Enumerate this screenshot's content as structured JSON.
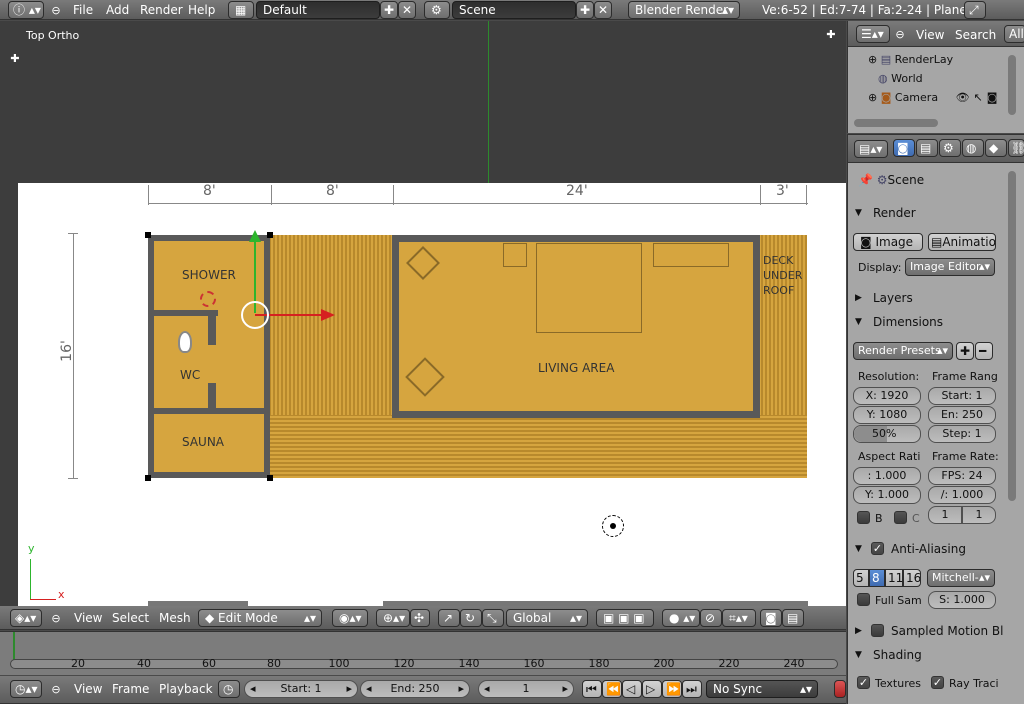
{
  "colors": {
    "viewport_bg": "#3d3d3d",
    "props_bg": "#a6a6a6",
    "floor_yellow": "#d6a53f",
    "wall": "#595959",
    "timeline_bg": "#7c7c7c"
  },
  "topbar": {
    "menus": [
      "File",
      "Add",
      "Render",
      "Help"
    ],
    "layout": "Default",
    "scene": "Scene",
    "engine": "Blender Render",
    "stats": "Ve:6-52 | Ed:7-74 | Fa:2-24 | Plane"
  },
  "viewport": {
    "label": "Top Ortho",
    "plan": {
      "dims": [
        "8'",
        "8'",
        "24'",
        "3'"
      ],
      "side_dim": "16'",
      "rooms": {
        "shower": "SHOWER",
        "wc": "WC",
        "sauna": "SAUNA",
        "living": "LIVING AREA",
        "deck": [
          "DECK",
          "UNDER",
          "ROOF"
        ]
      }
    },
    "axis_y": "y",
    "axis_x": "x"
  },
  "viewport_header": {
    "menus": [
      "View",
      "Select",
      "Mesh"
    ],
    "mode": "Edit Mode",
    "orientation": "Global"
  },
  "timeline": {
    "ticks": [
      "20",
      "40",
      "60",
      "80",
      "100",
      "120",
      "140",
      "160",
      "180",
      "200",
      "220",
      "240"
    ],
    "menus": [
      "View",
      "Frame",
      "Playback"
    ],
    "start": "Start: 1",
    "end": "End: 250",
    "current": "1",
    "sync": "No Sync"
  },
  "outliner": {
    "menus": [
      "View",
      "Search"
    ],
    "filter": "All",
    "items": [
      "RenderLay",
      "World",
      "Camera"
    ]
  },
  "properties": {
    "scene_label": "Scene",
    "render": {
      "title": "Render",
      "image_btn": "Image",
      "animation_btn": "Animation",
      "display_label": "Display:",
      "display_value": "Image Editor"
    },
    "layers_title": "Layers",
    "dimensions": {
      "title": "Dimensions",
      "presets": "Render Presets",
      "resolution_label": "Resolution:",
      "res_x": "X: 1920",
      "res_y": "Y: 1080",
      "res_pct": "50%",
      "res_pct_value": 0.5,
      "frame_range_label": "Frame Rang",
      "start": "Start: 1",
      "end": "En: 250",
      "step": "Step: 1",
      "aspect_label": "Aspect Rati",
      "aspect_x": ": 1.000",
      "aspect_y": "Y: 1.000",
      "frame_rate_label": "Frame Rate:",
      "fps": "FPS: 24",
      "fps_base": "/: 1.000",
      "b_label": "B",
      "c_label": "C",
      "time_old": "1",
      "time_new": "1"
    },
    "anti_aliasing": {
      "title": "Anti-Aliasing",
      "samples": [
        "5",
        "8",
        "11",
        "16"
      ],
      "selected": "8",
      "filter": "Mitchell-",
      "full_sample": "Full Sam",
      "size": "S: 1.000"
    },
    "motion_blur_title": "Sampled Motion Blu",
    "shading": {
      "title": "Shading",
      "textures": "Textures",
      "ray_tracing": "Ray Traci"
    }
  }
}
